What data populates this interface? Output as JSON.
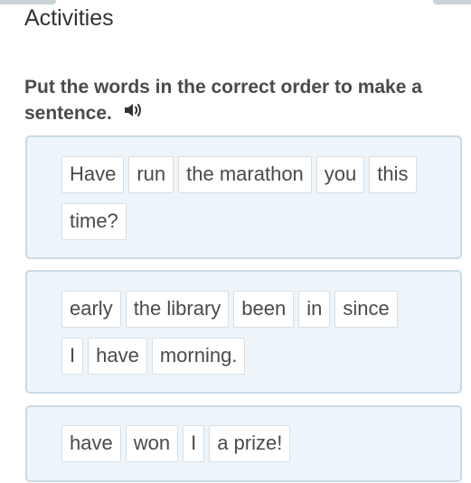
{
  "page": {
    "title": "Activities"
  },
  "exercise": {
    "instruction": "Put the words in the correct order to make a sentence.",
    "speaker_icon": "speaker-icon"
  },
  "sentences": [
    {
      "lines": [
        [
          "Have",
          "run",
          "the marathon",
          "you"
        ],
        [
          "this",
          "time?"
        ]
      ]
    },
    {
      "lines": [
        [
          "early",
          "the library",
          "been",
          "in",
          "since"
        ],
        [
          "I",
          "have",
          "morning."
        ]
      ]
    },
    {
      "lines": [
        [
          "have",
          "won",
          "I",
          "a prize!"
        ]
      ]
    }
  ],
  "colors": {
    "card_background": "#eef5fa",
    "card_border": "#c9dbe6",
    "tile_border": "#d8dfe3",
    "text": "#4a4a4a"
  }
}
